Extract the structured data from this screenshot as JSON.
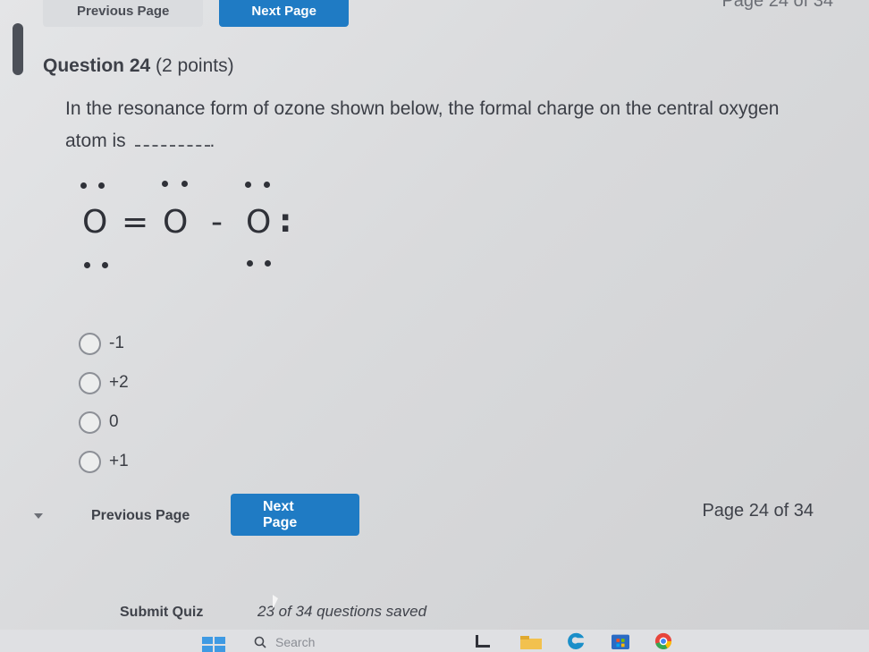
{
  "top_nav": {
    "prev_label": "Previous Page",
    "next_label": "Next Page",
    "page_label": "Page 24 of 34"
  },
  "question": {
    "title": "Question 24",
    "points": "(2 points)",
    "text_before": "In the resonance form of ozone shown below, the formal charge on the central oxygen atom is",
    "text_after": "."
  },
  "structure": {
    "atom1": "O",
    "bond1": "=",
    "atom2": "O",
    "bond2": "-",
    "atom3": "O",
    "colon": ":"
  },
  "options": [
    {
      "label": "-1"
    },
    {
      "label": "+2"
    },
    {
      "label": "0"
    },
    {
      "label": "+1"
    }
  ],
  "bottom_nav": {
    "prev_label": "Previous Page",
    "next_label": "Next Page",
    "page_label": "Page 24 of 34"
  },
  "footer": {
    "submit_label": "Submit Quiz",
    "saved_text": "23 of 34 questions saved"
  },
  "taskbar": {
    "search_placeholder": "Search"
  },
  "colors": {
    "accent": "#1f7bc4",
    "background": "#dcdddf",
    "text": "#3a3d44"
  }
}
